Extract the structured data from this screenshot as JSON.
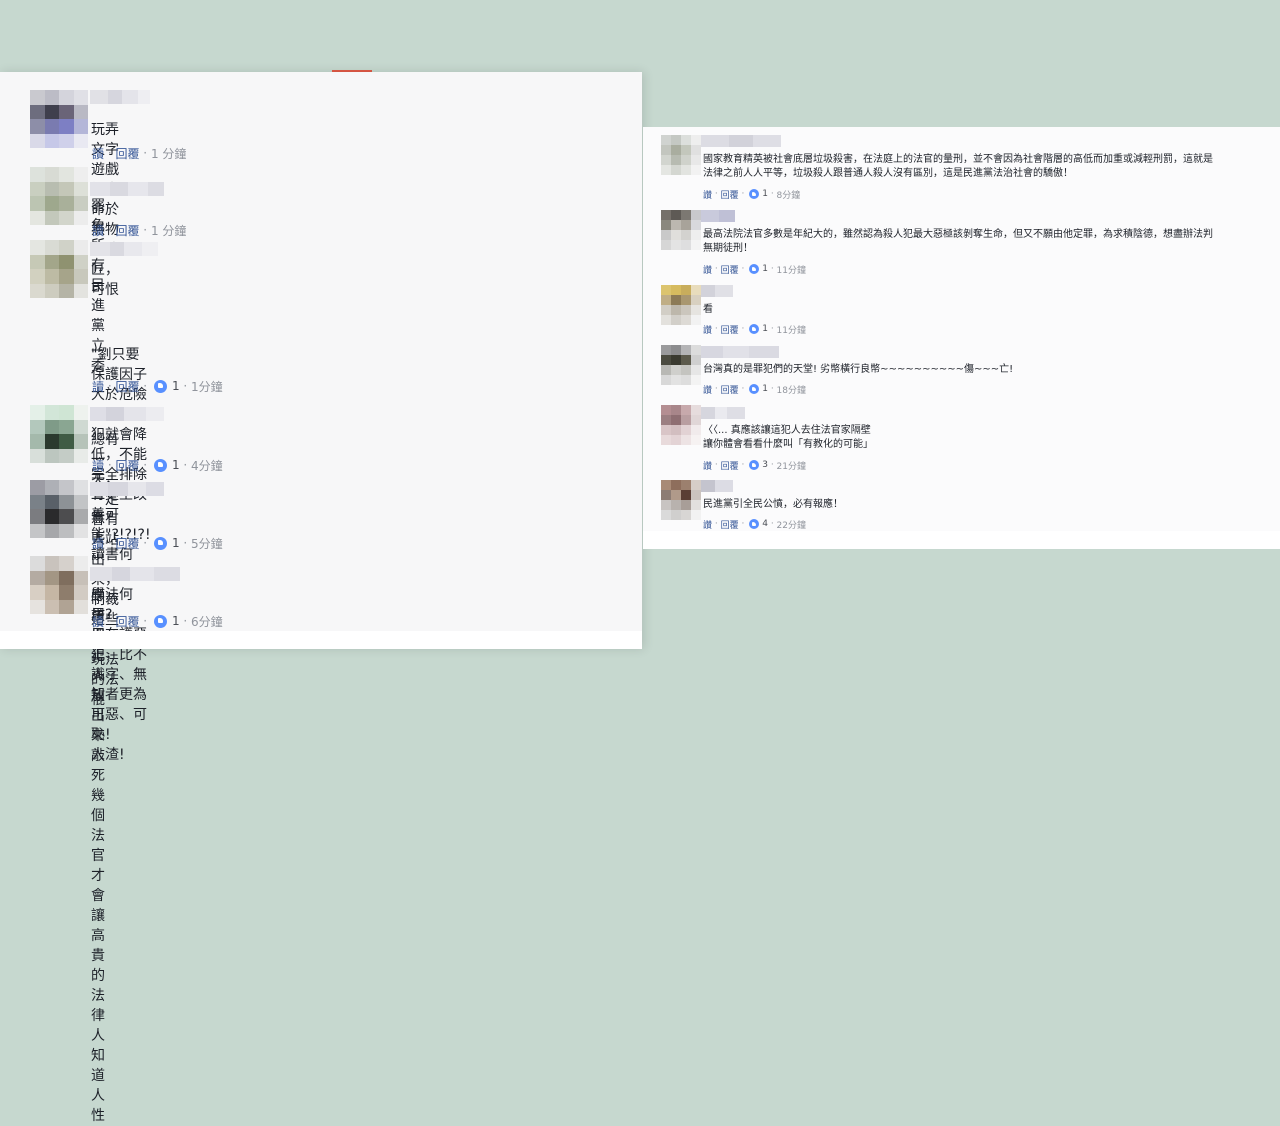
{
  "left_comments": [
    {
      "text": "玩弄文字遊戲視生命於無物的法匠，可恨",
      "reply": "讀",
      "reply2": "回覆",
      "likes": "",
      "time": "1 分鐘"
    },
    {
      "text": "罷免所有民進黨立委",
      "reply": "讀",
      "reply2": "回覆",
      "likes": "",
      "time": "1 分鐘"
    },
    {
      "text": "\"劉只要保護因子大於危險因子，再犯就會降低，不能完全排除有更生改善可能\"?!?!?!\n讀書何用?\n學法何用?\n用在護惡上，比不識字、無知者更為可惡、可恥!\n人渣!",
      "reply": "讀",
      "reply2": "回覆",
      "likes": "1",
      "time": "1分鐘"
    },
    {
      "text": "總有一天，一定會有人站出來，制裁這些知法玩法的法棍",
      "reply": "讀",
      "reply2": "回覆",
      "likes": "1",
      "time": "4分鐘"
    },
    {
      "text": "無言...",
      "reply": "讀",
      "reply2": "回覆",
      "likes": "1",
      "time": "5分鐘"
    },
    {
      "text": "應該把犯人放出來敲死幾個法官才會讓高貴的法律人知道人性",
      "reply": "讀",
      "reply2": "回覆",
      "likes": "1",
      "time": "6分鐘"
    }
  ],
  "right_comments": [
    {
      "text": "國家教育精英被社會底層垃圾殺害，在法庭上的法官的量刑，並不會因為社會階層的高低而加重或減輕刑罰，這就是\n法律之前人人平等，垃圾殺人跟普通人殺人沒有區別，這是民進黨法治社會的驕傲！",
      "reply": "讚",
      "reply2": "回覆",
      "likes": "1",
      "time": "8分鐘"
    },
    {
      "text": "最高法院法官多數是年紀大的，雖然認為殺人犯最大惡極該剝奪生命，但又不願由他定罪，為求積陰德，想盡辦法判\n無期徒刑！",
      "reply": "讚",
      "reply2": "回覆",
      "likes": "1",
      "time": "11分鐘"
    },
    {
      "text": "看",
      "reply": "讚",
      "reply2": "回覆",
      "likes": "1",
      "time": "11分鐘"
    },
    {
      "text": "台灣真的是罪犯們的天堂! 劣幣橫行良幣~~~~~~~~~~傷~~~亡!",
      "reply": "讚",
      "reply2": "回覆",
      "likes": "1",
      "time": "18分鐘"
    },
    {
      "text": "〈〈... 真應該讓這犯人去住法官家隔壁\n讓你體會看看什麼叫「有教化的可能」",
      "reply": "讚",
      "reply2": "回覆",
      "likes": "3",
      "time": "21分鐘"
    },
    {
      "text": "民進黨引全民公憤，必有報應！",
      "reply": "讚",
      "reply2": "回覆",
      "likes": "4",
      "time": "22分鐘"
    }
  ],
  "colors": {
    "background": "#c6d8cf",
    "panel": "#f7f7f8",
    "link": "#385898",
    "meta": "#90949c",
    "text": "#1d2129",
    "like_blue": "#5890ff"
  }
}
